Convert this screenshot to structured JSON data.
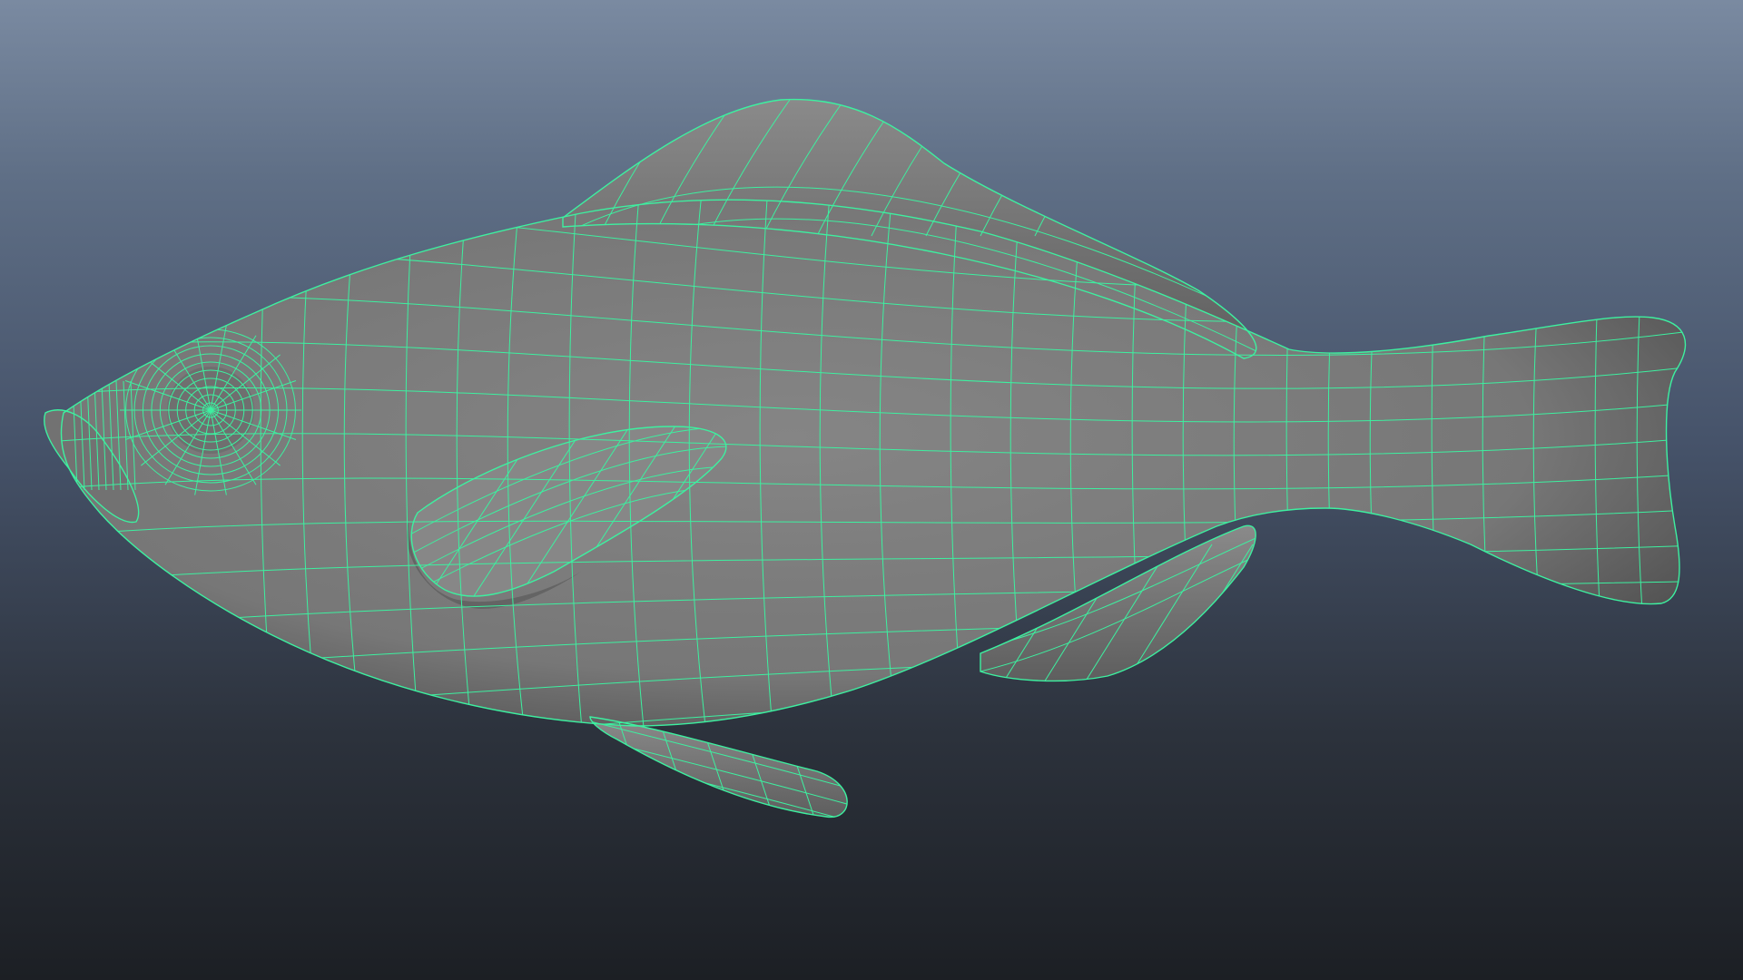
{
  "viewport": {
    "background_top": "#7a8aa1",
    "background_bottom": "#1c1f24"
  },
  "model": {
    "object": "fish-mesh",
    "display_mode": "wireframe-on-shaded",
    "surface_color": "#7d7d7d",
    "surface_shadow_color": "#4a4a4a",
    "wireframe_color": "#3df0a0"
  }
}
